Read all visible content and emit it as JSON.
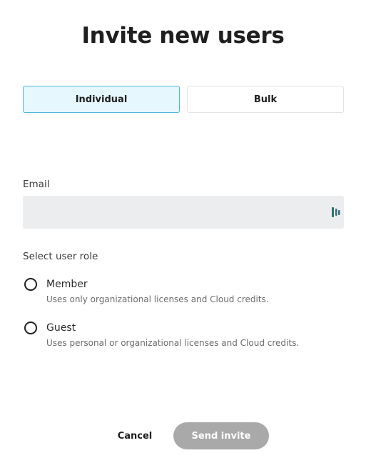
{
  "dialog": {
    "title": "Invite new users"
  },
  "tabs": [
    {
      "label": "Individual",
      "active": true
    },
    {
      "label": "Bulk",
      "active": false
    }
  ],
  "email": {
    "label": "Email",
    "value": "",
    "placeholder": "",
    "icon": "password-manager-icon"
  },
  "role": {
    "label": "Select user role",
    "options": [
      {
        "name": "Member",
        "description": "Uses only organizational licenses and Cloud credits.",
        "selected": false
      },
      {
        "name": "Guest",
        "description": "Uses personal or organizational licenses and Cloud credits.",
        "selected": false
      }
    ]
  },
  "actions": {
    "cancel_label": "Cancel",
    "send_label": "Send invite",
    "send_enabled": false
  },
  "colors": {
    "active_tab_bg": "#e6f7fd",
    "active_tab_border": "#4fb7df",
    "input_bg": "#ecedef",
    "disabled_button": "#a9a9a9",
    "icon_teal": "#2f6f7a"
  }
}
